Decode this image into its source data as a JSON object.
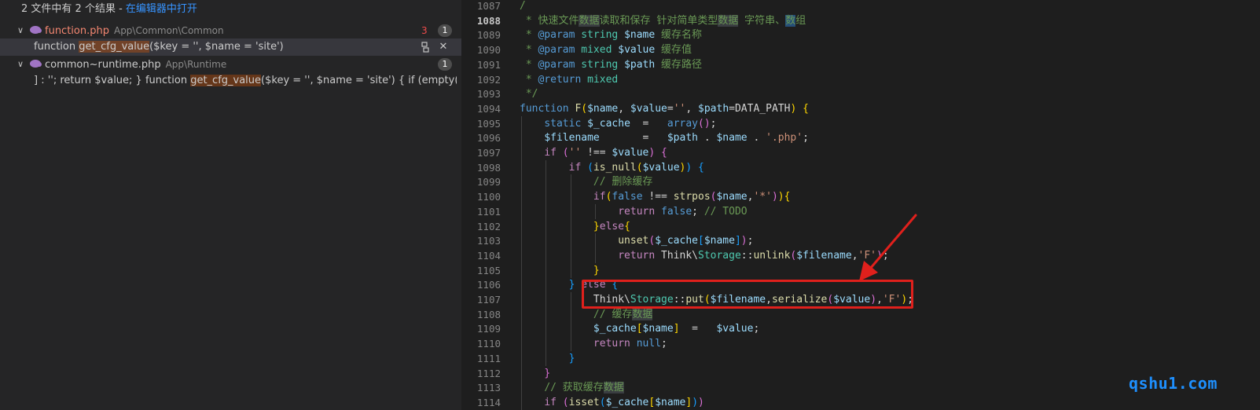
{
  "search": {
    "summary_prefix": "2 文件中有 2 个结果 - ",
    "summary_link": "在编辑器中打开",
    "files": [
      {
        "name": "function.php",
        "path": "App\\Common\\Common",
        "warn_count": "3",
        "match_count": "1",
        "match": {
          "before": "function ",
          "hit": "get_cfg_value",
          "after": "($key = '', $name = 'site')"
        }
      },
      {
        "name": "common~runtime.php",
        "path": "App\\Runtime",
        "match_count": "1",
        "match": {
          "before": "] : ''; return $value; } function ",
          "hit": "get_cfg_value",
          "after": "($key = '', $name = 'site') { if (empty($name)) { retur..."
        }
      }
    ]
  },
  "editor": {
    "lines": [
      {
        "n": "1087",
        "html": "<span class='c-com'>/</span>"
      },
      {
        "n": "1088",
        "html": "<span class='c-com'> * 快速文件<span class='wordhl'>数据</span>读取和保存 针对简单类型<span class='wordhl'>数据</span> 字符串、<span class='wordhl-strong'>数</span>组</span>"
      },
      {
        "n": "1089",
        "html": "<span class='c-com'> * </span><span class='c-kw'>@param</span><span class='c-com'> </span><span class='c-cls'>string</span><span class='c-com'> </span><span class='c-var'>$name</span><span class='c-com'> 缓存名称</span>"
      },
      {
        "n": "1090",
        "html": "<span class='c-com'> * </span><span class='c-kw'>@param</span><span class='c-com'> </span><span class='c-cls'>mixed</span><span class='c-com'> </span><span class='c-var'>$value</span><span class='c-com'> 缓存值</span>"
      },
      {
        "n": "1091",
        "html": "<span class='c-com'> * </span><span class='c-kw'>@param</span><span class='c-com'> </span><span class='c-cls'>string</span><span class='c-com'> </span><span class='c-var'>$path</span><span class='c-com'> 缓存路径</span>"
      },
      {
        "n": "1092",
        "html": "<span class='c-com'> * </span><span class='c-kw'>@return</span><span class='c-com'> </span><span class='c-cls'>mixed</span>"
      },
      {
        "n": "1093",
        "html": "<span class='c-com'> */</span>"
      },
      {
        "n": "1094",
        "html": "<span class='c-kw'>function</span> <span class='c-fn'>F</span><span class='c-br1'>(</span><span class='c-var'>$name</span>, <span class='c-var'>$value</span>=<span class='c-str'>''</span>, <span class='c-var'>$path</span>=DATA_PATH<span class='c-br1'>)</span> <span class='c-br1'>{</span>"
      },
      {
        "n": "1095",
        "html": "    <span class='c-kw'>static</span> <span class='c-var'>$_cache</span>  =   <span class='c-kw'>array</span><span class='c-br2'>()</span>;"
      },
      {
        "n": "1096",
        "html": "    <span class='c-var'>$filename</span>       =   <span class='c-var'>$path</span> . <span class='c-var'>$name</span> . <span class='c-str'>'.php'</span>;"
      },
      {
        "n": "1097",
        "html": "    <span class='c-ctl'>if</span> <span class='c-br2'>(</span><span class='c-str'>''</span> !== <span class='c-var'>$value</span><span class='c-br2'>)</span> <span class='c-br2'>{</span>"
      },
      {
        "n": "1098",
        "html": "        <span class='c-ctl'>if</span> <span class='c-br3'>(</span><span class='c-fn'>is_null</span><span class='c-br1'>(</span><span class='c-var'>$value</span><span class='c-br1'>)</span><span class='c-br3'>)</span> <span class='c-br3'>{</span>"
      },
      {
        "n": "1099",
        "html": "            <span class='c-com'>// 删除缓存</span>"
      },
      {
        "n": "1100",
        "html": "            <span class='c-ctl'>if</span><span class='c-br1'>(</span><span class='c-kw'>false</span> !== <span class='c-fn'>strpos</span><span class='c-br2'>(</span><span class='c-var'>$name</span>,<span class='c-str'>'*'</span><span class='c-br2'>)</span><span class='c-br1'>){</span>"
      },
      {
        "n": "1101",
        "html": "                <span class='c-ctl'>return</span> <span class='c-kw'>false</span>; <span class='c-com'>// TODO</span>"
      },
      {
        "n": "1102",
        "html": "            <span class='c-br1'>}</span><span class='c-ctl'>else</span><span class='c-br1'>{</span>"
      },
      {
        "n": "1103",
        "html": "                <span class='c-fn'>unset</span><span class='c-br2'>(</span><span class='c-var'>$_cache</span><span class='c-br3'>[</span><span class='c-var'>$name</span><span class='c-br3'>]</span><span class='c-br2'>)</span>;"
      },
      {
        "n": "1104",
        "html": "                <span class='c-ctl'>return</span> Think\\<span class='c-cls'>Storage</span>::<span class='c-fn'>unlink</span><span class='c-br2'>(</span><span class='c-var'>$filename</span>,<span class='c-str'>'F'</span><span class='c-br2'>)</span>;"
      },
      {
        "n": "1105",
        "html": "            <span class='c-br1'>}</span>"
      },
      {
        "n": "1106",
        "html": "        <span class='c-br3'>}</span> <span class='c-ctl'>else</span> <span class='c-br3'>{</span>"
      },
      {
        "n": "1107",
        "html": "            Think\\<span class='c-cls'>Storage</span>::<span class='c-fn'>put</span><span class='c-br1'>(</span><span class='c-var'>$filename</span>,<span class='c-fn'>serialize</span><span class='c-br2'>(</span><span class='c-var'>$value</span><span class='c-br2'>)</span>,<span class='c-str'>'F'</span><span class='c-br1'>)</span>;"
      },
      {
        "n": "1108",
        "html": "            <span class='c-com'>// 缓存<span class='wordhl'>数据</span></span>"
      },
      {
        "n": "1109",
        "html": "            <span class='c-var'>$_cache</span><span class='c-br1'>[</span><span class='c-var'>$name</span><span class='c-br1'>]</span>  =   <span class='c-var'>$value</span>;"
      },
      {
        "n": "1110",
        "html": "            <span class='c-ctl'>return</span> <span class='c-kw'>null</span>;"
      },
      {
        "n": "1111",
        "html": "        <span class='c-br3'>}</span>"
      },
      {
        "n": "1112",
        "html": "    <span class='c-br2'>}</span>"
      },
      {
        "n": "1113",
        "html": "    <span class='c-com'>// 获取缓存<span class='wordhl'>数据</span></span>"
      },
      {
        "n": "1114",
        "html": "    <span class='c-ctl'>if</span> <span class='c-br2'>(</span><span class='c-fn'>isset</span><span class='c-br3'>(</span><span class='c-var'>$_cache</span><span class='c-br1'>[</span><span class='c-var'>$name</span><span class='c-br1'>]</span><span class='c-br3'>)</span><span class='c-br2'>)</span>"
      }
    ],
    "active_line": "1088"
  },
  "annotation": {
    "box_color": "#e0201c"
  },
  "watermark": "qshu1.com",
  "icons": {
    "expand": "chevron-down-icon",
    "file": "php-elephant-icon",
    "replace": "replace-icon",
    "dismiss": "close-icon"
  }
}
